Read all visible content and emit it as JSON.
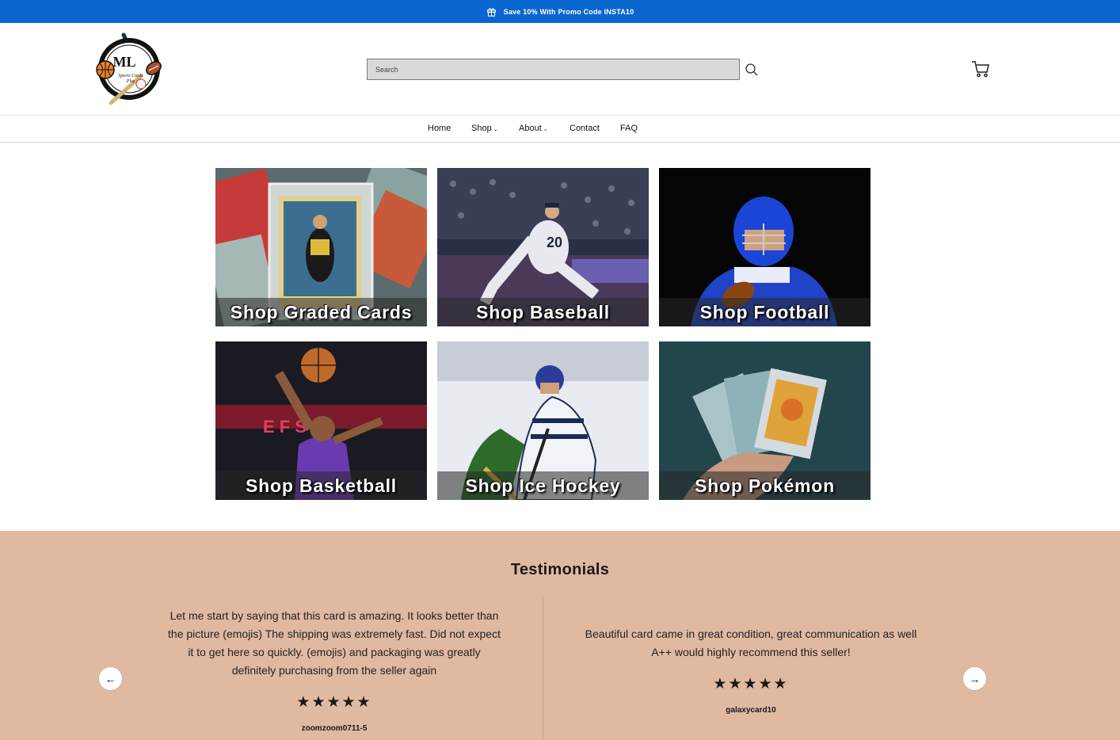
{
  "promo": {
    "text": "Save 10% With Promo Code INSTA10",
    "icon": "gift-icon"
  },
  "header": {
    "logo": {
      "main_text": "ML",
      "script_text": "Sports Cards Plus"
    },
    "search": {
      "placeholder": "Search"
    }
  },
  "nav": {
    "items": [
      {
        "label": "Home",
        "has_dropdown": false
      },
      {
        "label": "Shop",
        "has_dropdown": true
      },
      {
        "label": "About",
        "has_dropdown": true
      },
      {
        "label": "Contact",
        "has_dropdown": false
      },
      {
        "label": "FAQ",
        "has_dropdown": false
      }
    ],
    "dropdown_glyph": "⌄"
  },
  "tiles": [
    {
      "label": "Shop Graded Cards"
    },
    {
      "label": "Shop Baseball"
    },
    {
      "label": "Shop Football"
    },
    {
      "label": "Shop Basketball"
    },
    {
      "label": "Shop Ice Hockey"
    },
    {
      "label": "Shop Pokémon"
    }
  ],
  "testimonials": {
    "title": "Testimonials",
    "items": [
      {
        "quote": "Let me start by saying that this card is amazing. It looks better than the picture (emojis) The shipping was extremely fast. Did not expect it to get here so quickly. (emojis) and packaging was greatly definitely purchasing from the seller again",
        "stars": "★★★★★",
        "rating": 5,
        "author": "zoomzoom0711-5"
      },
      {
        "quote": "Beautiful card came in great condition, great communication as well A++ would highly recommend this seller!",
        "stars": "★★★★★",
        "rating": 5,
        "author": "galaxycard10"
      }
    ],
    "prev_glyph": "←",
    "next_glyph": "→"
  },
  "colors": {
    "promo_bar": "#0a66cf",
    "testimonials_bg": "#e0b9a1",
    "search_bg": "#d9d9d9"
  }
}
